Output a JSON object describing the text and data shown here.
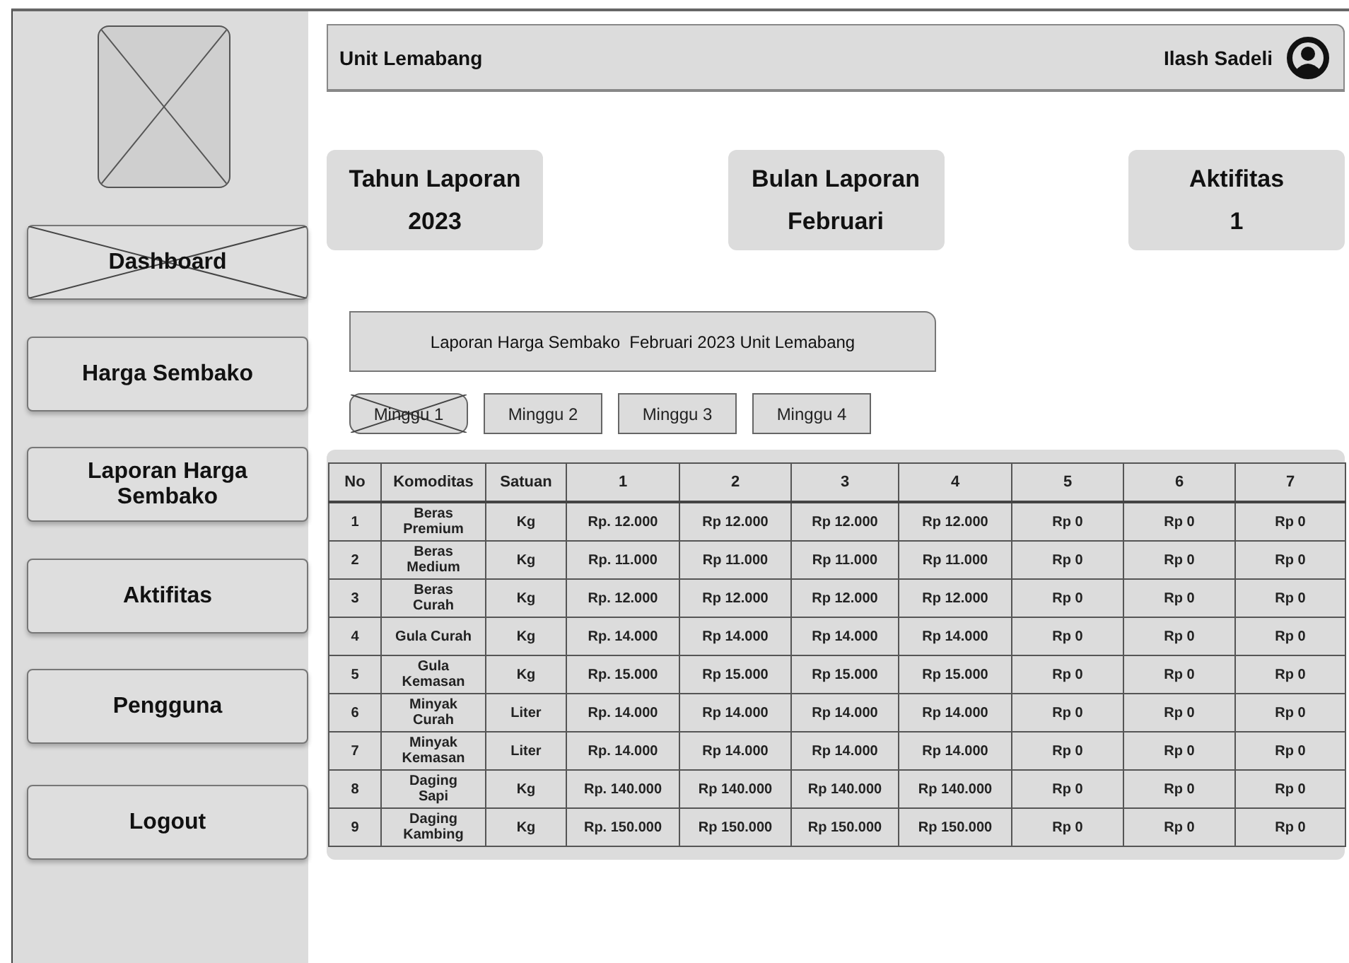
{
  "sidebar": {
    "items": [
      {
        "label": "Dashboard",
        "selected": true
      },
      {
        "label": "Harga Sembako",
        "selected": false
      },
      {
        "label": "Laporan Harga Sembako",
        "selected": false
      },
      {
        "label": "Aktifitas",
        "selected": false
      },
      {
        "label": "Pengguna",
        "selected": false
      },
      {
        "label": "Logout",
        "selected": false
      }
    ]
  },
  "header": {
    "unit": "Unit Lemabang",
    "user": "Ilash Sadeli"
  },
  "stats": [
    {
      "label": "Tahun Laporan",
      "value": "2023"
    },
    {
      "label": "Bulan Laporan",
      "value": "Februari"
    },
    {
      "label": "Aktifitas",
      "value": "1"
    }
  ],
  "report_title": "Laporan Harga Sembako  Februari 2023 Unit Lemabang",
  "weeks": [
    {
      "label": "Minggu 1",
      "selected": true
    },
    {
      "label": "Minggu 2",
      "selected": false
    },
    {
      "label": "Minggu 3",
      "selected": false
    },
    {
      "label": "Minggu 4",
      "selected": false
    }
  ],
  "table": {
    "columns": [
      "No",
      "Komoditas",
      "Satuan",
      "1",
      "2",
      "3",
      "4",
      "5",
      "6",
      "7"
    ],
    "rows": [
      [
        "1",
        "Beras Premium",
        "Kg",
        "Rp. 12.000",
        "Rp 12.000",
        "Rp 12.000",
        "Rp 12.000",
        "Rp 0",
        "Rp 0",
        "Rp 0"
      ],
      [
        "2",
        "Beras Medium",
        "Kg",
        "Rp. 11.000",
        "Rp 11.000",
        "Rp 11.000",
        "Rp 11.000",
        "Rp 0",
        "Rp 0",
        "Rp 0"
      ],
      [
        "3",
        "Beras Curah",
        "Kg",
        "Rp. 12.000",
        "Rp 12.000",
        "Rp 12.000",
        "Rp 12.000",
        "Rp 0",
        "Rp 0",
        "Rp 0"
      ],
      [
        "4",
        "Gula Curah",
        "Kg",
        "Rp. 14.000",
        "Rp 14.000",
        "Rp 14.000",
        "Rp 14.000",
        "Rp 0",
        "Rp 0",
        "Rp 0"
      ],
      [
        "5",
        "Gula Kemasan",
        "Kg",
        "Rp. 15.000",
        "Rp 15.000",
        "Rp 15.000",
        "Rp 15.000",
        "Rp 0",
        "Rp 0",
        "Rp 0"
      ],
      [
        "6",
        "Minyak Curah",
        "Liter",
        "Rp. 14.000",
        "Rp 14.000",
        "Rp 14.000",
        "Rp 14.000",
        "Rp 0",
        "Rp 0",
        "Rp 0"
      ],
      [
        "7",
        "Minyak Kemasan",
        "Liter",
        "Rp. 14.000",
        "Rp 14.000",
        "Rp 14.000",
        "Rp 14.000",
        "Rp 0",
        "Rp 0",
        "Rp 0"
      ],
      [
        "8",
        "Daging Sapi",
        "Kg",
        "Rp. 140.000",
        "Rp 140.000",
        "Rp 140.000",
        "Rp 140.000",
        "Rp 0",
        "Rp 0",
        "Rp 0"
      ],
      [
        "9",
        "Daging Kambing",
        "Kg",
        "Rp. 150.000",
        "Rp 150.000",
        "Rp 150.000",
        "Rp 150.000",
        "Rp 0",
        "Rp 0",
        "Rp 0"
      ]
    ]
  }
}
